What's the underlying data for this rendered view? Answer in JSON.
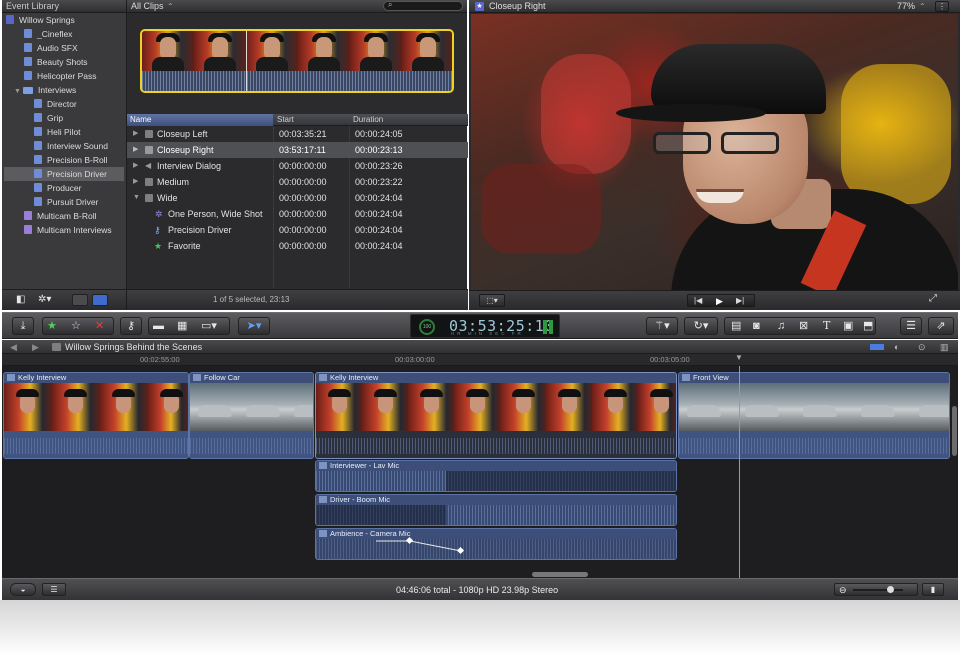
{
  "event_library": {
    "title": "Event Library",
    "items": [
      {
        "label": "Willow Springs",
        "type": "star"
      },
      {
        "label": "_Cineflex",
        "type": "kw"
      },
      {
        "label": "Audio SFX",
        "type": "kw"
      },
      {
        "label": "Beauty Shots",
        "type": "kw"
      },
      {
        "label": "Helicopter Pass",
        "type": "kw"
      },
      {
        "label": "Interviews",
        "type": "folder"
      },
      {
        "label": "Director",
        "type": "kw"
      },
      {
        "label": "Grip",
        "type": "kw"
      },
      {
        "label": "Heli Pilot",
        "type": "kw"
      },
      {
        "label": "Interview Sound",
        "type": "kw"
      },
      {
        "label": "Precision B-Roll",
        "type": "kw"
      },
      {
        "label": "Precision Driver",
        "type": "kw"
      },
      {
        "label": "Producer",
        "type": "kw"
      },
      {
        "label": "Pursuit Driver",
        "type": "kw"
      },
      {
        "label": "Multicam B-Roll",
        "type": "mc"
      },
      {
        "label": "Multicam Interviews",
        "type": "mc"
      }
    ]
  },
  "browser": {
    "filter": "All Clips",
    "columns": {
      "name": "Name",
      "start": "Start",
      "duration": "Duration"
    },
    "rows": [
      {
        "name": "Closeup Left",
        "start": "00:03:35:21",
        "duration": "00:00:24:05"
      },
      {
        "name": "Closeup Right",
        "start": "03:53:17:11",
        "duration": "00:00:23:13"
      },
      {
        "name": "Interview Dialog",
        "start": "00:00:00:00",
        "duration": "00:00:23:26"
      },
      {
        "name": "Medium",
        "start": "00:00:00:00",
        "duration": "00:00:23:22"
      },
      {
        "name": "Wide",
        "start": "00:00:00:00",
        "duration": "00:00:24:04"
      },
      {
        "name": "One Person, Wide Shot",
        "start": "00:00:00:00",
        "duration": "00:00:24:04"
      },
      {
        "name": "Precision Driver",
        "start": "00:00:00:00",
        "duration": "00:00:24:04"
      },
      {
        "name": "Favorite",
        "start": "00:00:00:00",
        "duration": "00:00:24:04"
      }
    ],
    "selection_status": "1 of 5 selected, 23:13"
  },
  "viewer": {
    "title": "Closeup Right",
    "zoom": "77%"
  },
  "toolbar": {
    "timecode": "03:53:25:10",
    "timecode_units": "HR MIN SEC FR",
    "meter_value": "100"
  },
  "timeline": {
    "project_title": "Willow Springs Behind the Scenes",
    "ruler": [
      "00:02:55:00",
      "00:03:00:00",
      "00:03:05:00"
    ],
    "clips": [
      {
        "title": "Kelly Interview"
      },
      {
        "title": "Follow Car"
      },
      {
        "title": "Kelly Interview"
      },
      {
        "title": "Front View"
      }
    ],
    "audio_clips": [
      {
        "title": "Interviewer - Lav Mic"
      },
      {
        "title": "Driver - Boom Mic"
      },
      {
        "title": "Ambience - Camera Mic"
      }
    ]
  },
  "status": {
    "summary": "04:46:06 total - 1080p HD 23.98p Stereo"
  }
}
